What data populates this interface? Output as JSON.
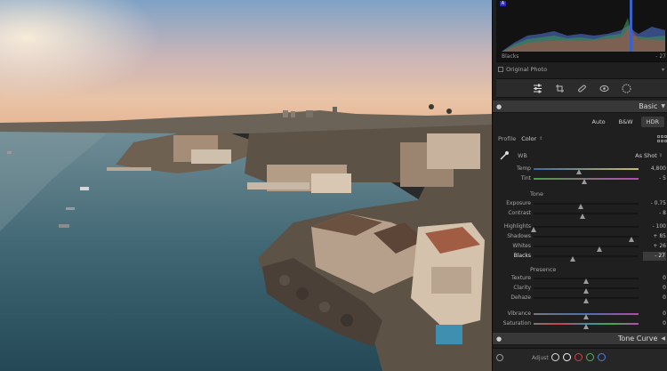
{
  "histogram": {
    "clip_indicator": "A",
    "channel_label": "Blacks",
    "channel_value": "- 27",
    "original_label": "Original Photo"
  },
  "tools": [
    "edit-sliders-icon",
    "crop-icon",
    "healing-icon",
    "redeye-icon",
    "mask-icon"
  ],
  "basic": {
    "title": "Basic",
    "treatment": {
      "auto": "Auto",
      "bw": "B&W",
      "hdr": "HDR"
    },
    "profile_label": "Profile",
    "profile_value": "Color",
    "wb_label": "WB",
    "wb_value": "As Shot",
    "wb_sliders": [
      {
        "label": "Temp",
        "value": "4,800",
        "pos": 0.43
      },
      {
        "label": "Tint",
        "value": "- 5",
        "pos": 0.48
      }
    ],
    "tone_label": "Tone",
    "tone_sliders": [
      {
        "label": "Exposure",
        "value": "- 0.75",
        "pos": 0.45
      },
      {
        "label": "Contrast",
        "value": "- 8",
        "pos": 0.47
      }
    ],
    "tone_sliders2": [
      {
        "label": "Highlights",
        "value": "- 100",
        "pos": 0.0
      },
      {
        "label": "Shadows",
        "value": "+ 85",
        "pos": 0.93
      },
      {
        "label": "Whites",
        "value": "+ 26",
        "pos": 0.63
      },
      {
        "label": "Blacks",
        "value": "- 27",
        "pos": 0.37,
        "active": true
      }
    ],
    "presence_label": "Presence",
    "presence_sliders": [
      {
        "label": "Texture",
        "value": "0",
        "pos": 0.5
      },
      {
        "label": "Clarity",
        "value": "0",
        "pos": 0.5
      },
      {
        "label": "Dehaze",
        "value": "0",
        "pos": 0.5
      }
    ],
    "color_sliders": [
      {
        "label": "Vibrance",
        "value": "0",
        "pos": 0.5
      },
      {
        "label": "Saturation",
        "value": "0",
        "pos": 0.5
      }
    ]
  },
  "tone_curve": {
    "title": "Tone Curve"
  },
  "bottom": {
    "adjust_label": "Adjust"
  },
  "colors": {
    "panel": "#1f1f1f",
    "header": "#383838",
    "accent": "#2c2cc4"
  }
}
